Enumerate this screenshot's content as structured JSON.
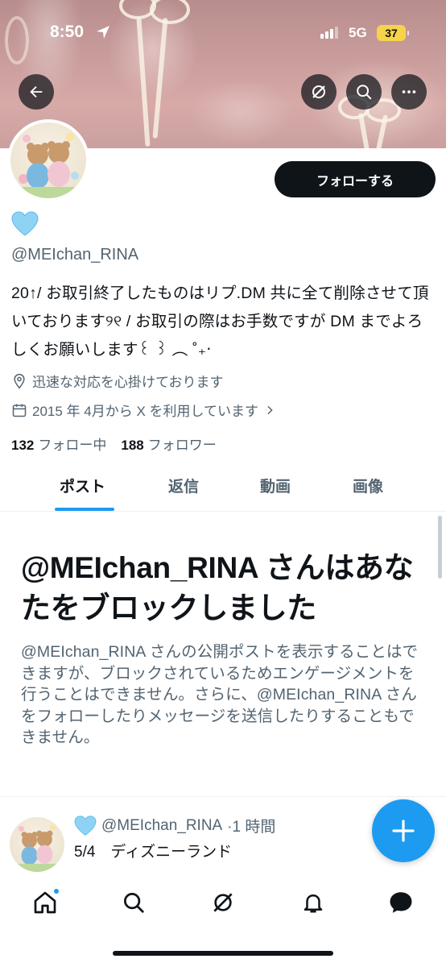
{
  "status_bar": {
    "time": "8:50",
    "network": "5G",
    "battery": "37"
  },
  "profile": {
    "follow_label": "フォローする",
    "emoji": "🩵",
    "handle": "@MEIchan_RINA",
    "bio": "20↑/ お取引終了したものはリプ.DM 共に全て削除させて頂いております୨୧ / お取引の際はお手数ですが DM までよろしくお願いします꒰ ꒱ ︵ ˚₊‧",
    "location": "迅速な対応を心掛けております",
    "joined": "2015 年 4月から X を利用しています",
    "following_count": "132",
    "following_label": "フォロー中",
    "followers_count": "188",
    "followers_label": "フォロワー"
  },
  "tabs": [
    {
      "label": "ポスト",
      "active": true
    },
    {
      "label": "返信",
      "active": false
    },
    {
      "label": "動画",
      "active": false
    },
    {
      "label": "画像",
      "active": false
    }
  ],
  "blocked": {
    "title": "@MEIchan_RINA さんはあなたをブロックしました",
    "description": "@MEIchan_RINA さんの公開ポストを表示することはできますが、ブロックされているためエンゲージメントを行うことはできません。さらに、@MEIchan_RINA さんをフォローしたりメッセージを送信したりすることもできません。"
  },
  "tweet_preview": {
    "emoji": "🩵",
    "handle": "@MEIchan_RINA",
    "time": "·1 時間",
    "text": "5/4　ディズニーランド"
  },
  "icons": {
    "back": "arrow-left-icon",
    "grok": "grok-icon",
    "search": "search-icon",
    "more": "more-icon",
    "location": "location-pin-icon",
    "calendar": "calendar-icon",
    "compose": "plus-icon",
    "home": "home-icon",
    "notifications": "bell-icon",
    "messages": "message-icon"
  },
  "colors": {
    "accent": "#1d9bf0",
    "text": "#0f1419",
    "muted": "#536471"
  }
}
